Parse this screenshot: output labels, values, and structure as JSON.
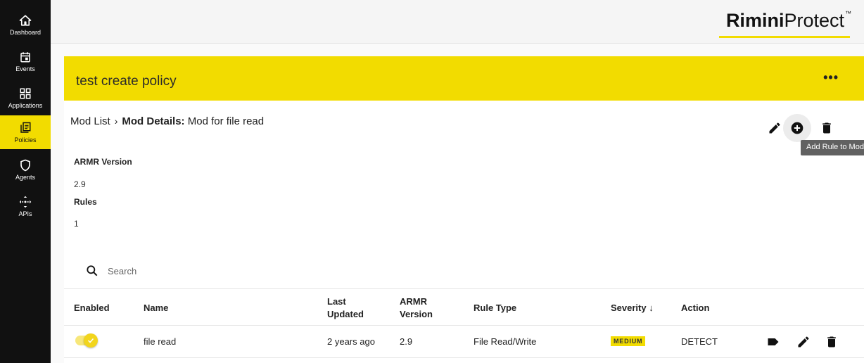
{
  "sidebar": {
    "items": [
      {
        "label": "Dashboard",
        "icon": "home-icon"
      },
      {
        "label": "Events",
        "icon": "calendar-icon"
      },
      {
        "label": "Applications",
        "icon": "grid-icon"
      },
      {
        "label": "Policies",
        "icon": "policies-icon",
        "active": true
      },
      {
        "label": "Agents",
        "icon": "shield-icon"
      },
      {
        "label": "APIs",
        "icon": "api-icon"
      }
    ]
  },
  "brand": {
    "bold": "Rimini",
    "light": "Protect",
    "tm": "™",
    "accent": "#f2dc00"
  },
  "policy": {
    "title": "test create policy",
    "more_label": "•••"
  },
  "breadcrumb": {
    "parent": "Mod List",
    "separator": "›",
    "current_label": "Mod Details:",
    "current_value": "Mod for file read"
  },
  "actions": {
    "edit_icon": "pencil-icon",
    "add_icon": "add-circle-icon",
    "delete_icon": "trash-icon",
    "tooltip": "Add Rule to Mod"
  },
  "details": {
    "armr_label": "ARMR Version",
    "armr_value": "2.9",
    "rules_label": "Rules",
    "rules_value": "1"
  },
  "search": {
    "placeholder": "Search"
  },
  "table": {
    "headers": {
      "enabled": "Enabled",
      "name": "Name",
      "last_updated_1": "Last",
      "last_updated_2": "Updated",
      "armr_1": "ARMR",
      "armr_2": "Version",
      "rule_type": "Rule Type",
      "severity": "Severity",
      "severity_sort": "↓",
      "action": "Action"
    },
    "rows": [
      {
        "enabled": true,
        "name": "file read",
        "last_updated": "2 years ago",
        "armr_version": "2.9",
        "rule_type": "File Read/Write",
        "severity": "MEDIUM",
        "action": "DETECT"
      }
    ]
  }
}
